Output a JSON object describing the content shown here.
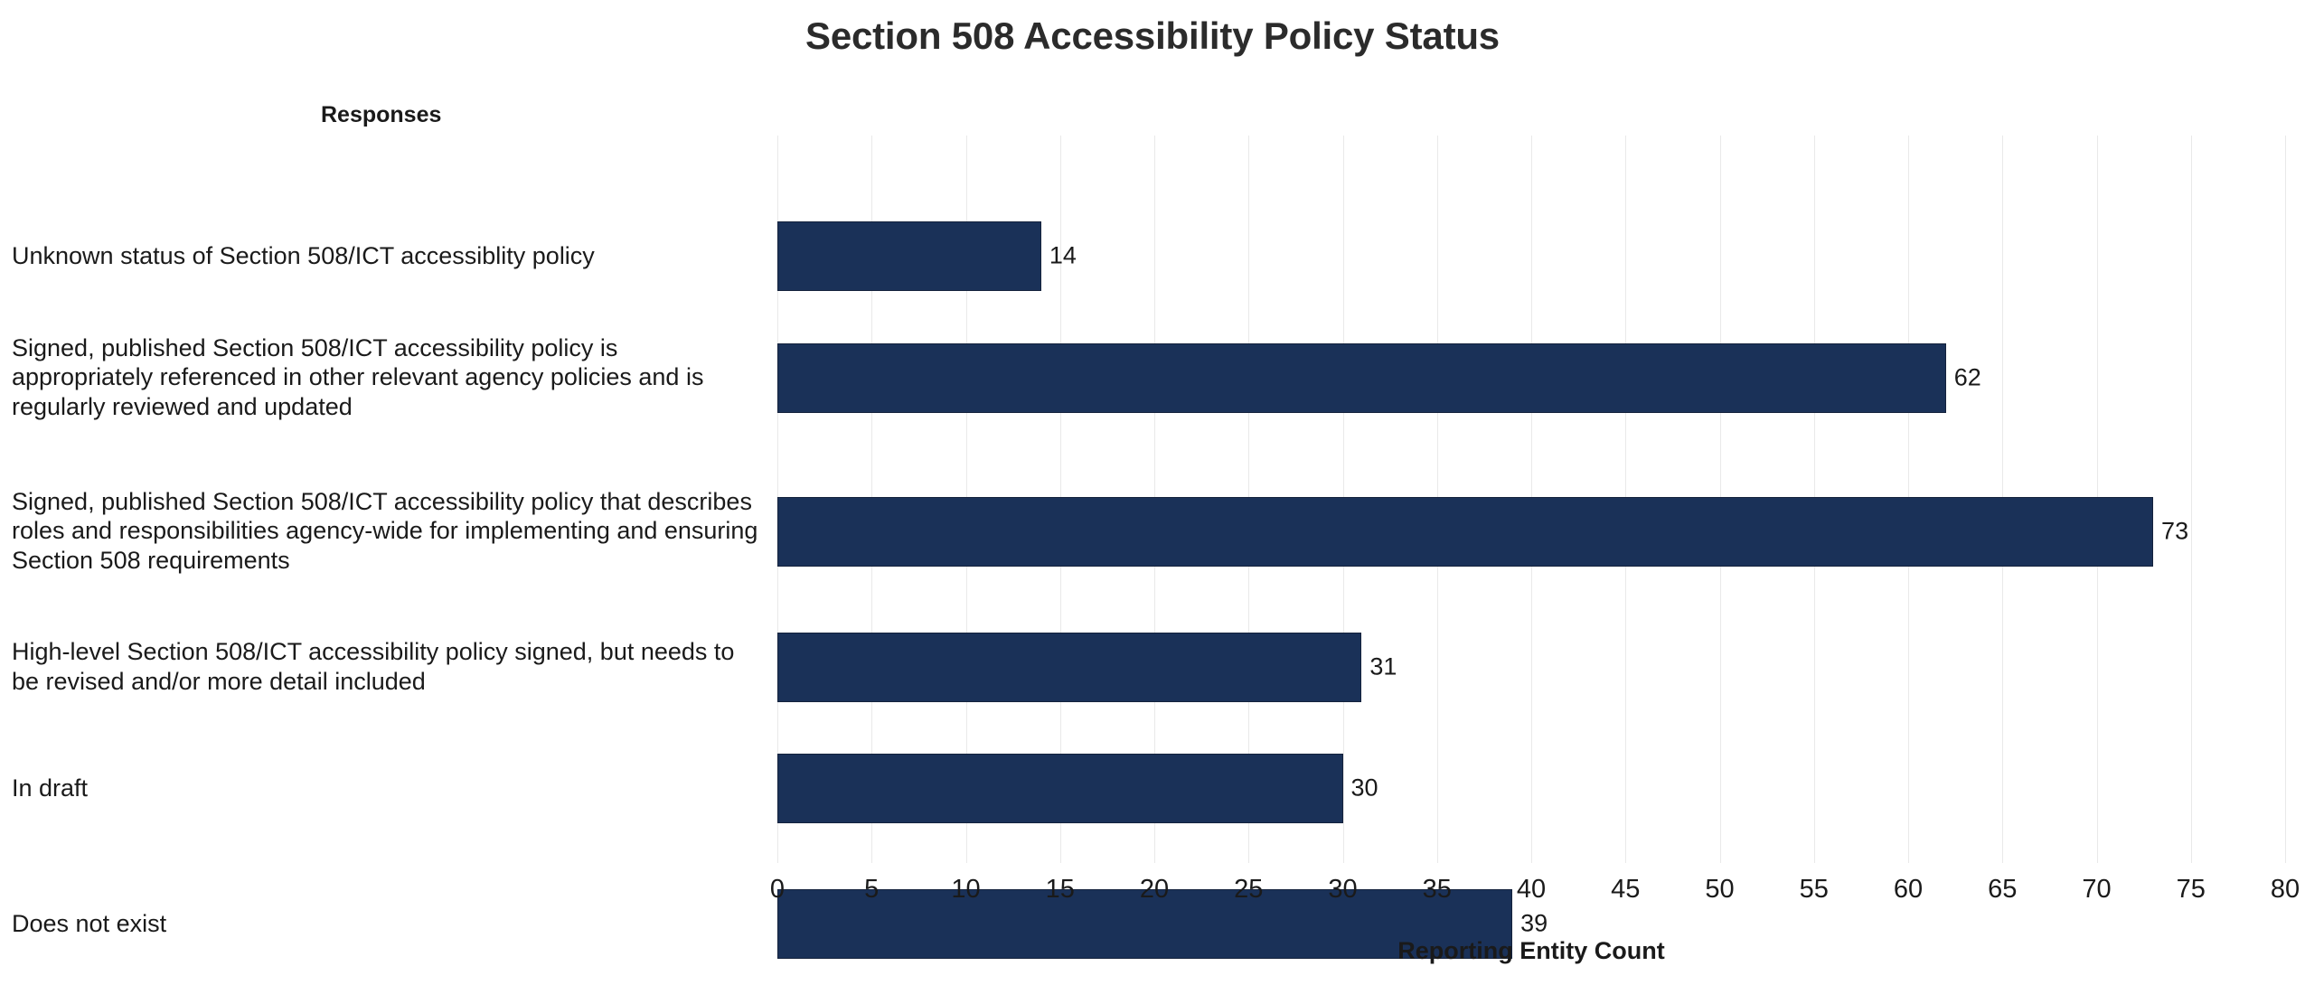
{
  "chart_data": {
    "type": "bar",
    "orientation": "horizontal",
    "title": "Section 508 Accessibility Policy Status",
    "xlabel": "Reporting Entity Count",
    "ylabel": "Responses",
    "xlim": [
      0,
      80
    ],
    "xticks": [
      0,
      5,
      10,
      15,
      20,
      25,
      30,
      35,
      40,
      45,
      50,
      55,
      60,
      65,
      70,
      75,
      80
    ],
    "grid": "vertical",
    "legend": "none",
    "bar_color": "#1a3158",
    "bar_edge_color": "#14223c",
    "gridline_color": "#e9e9e9",
    "background_color": "#ffffff",
    "categories": [
      "Unknown status of Section 508/ICT accessiblity policy",
      "Signed, published Section 508/ICT accessibility policy is appropriately referenced in other relevant agency policies and is regularly reviewed and updated",
      "Signed, published Section 508/ICT accessibility policy that describes roles and responsibilities agency-wide for implementing and ensuring Section 508 requirements",
      "High-level Section 508/ICT accessibility policy signed, but needs to be revised and/or more detail included",
      "In draft",
      "Does not exist"
    ],
    "values": [
      14,
      62,
      73,
      31,
      30,
      39
    ],
    "value_labels": [
      "14",
      "62",
      "73",
      "31",
      "30",
      "39"
    ]
  },
  "tick_labels": [
    "0",
    "5",
    "10",
    "15",
    "20",
    "25",
    "30",
    "35",
    "40",
    "45",
    "50",
    "55",
    "60",
    "65",
    "70",
    "75",
    "80"
  ]
}
